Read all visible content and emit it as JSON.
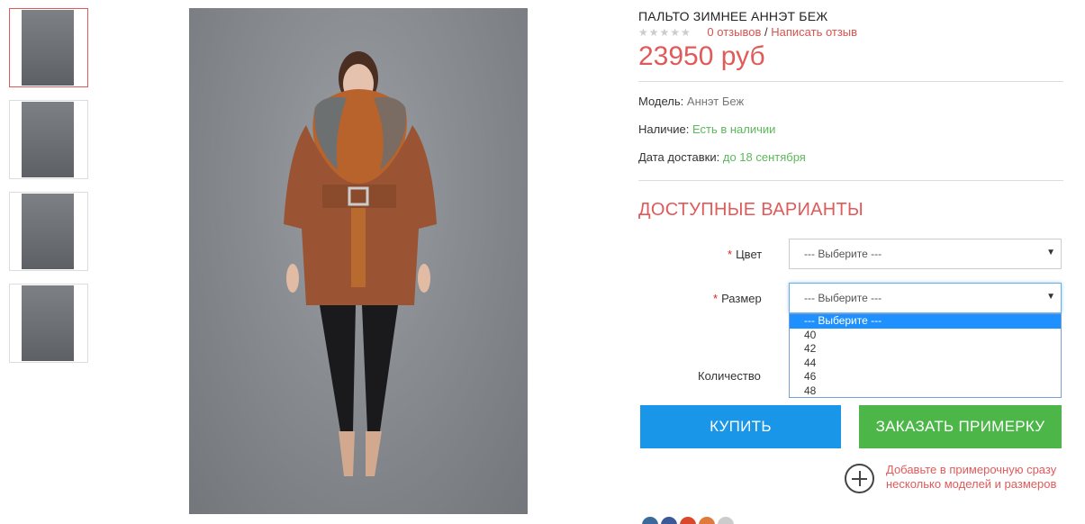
{
  "colors": {
    "accent_red": "#e05a5a",
    "buy_blue": "#1a96e8",
    "try_green": "#4cb649",
    "stock_green": "#5cb85c"
  },
  "thumbnails": [
    {
      "name": "thumb-1",
      "active": true
    },
    {
      "name": "thumb-2",
      "active": false
    },
    {
      "name": "thumb-3",
      "active": false
    },
    {
      "name": "thumb-4",
      "active": false
    }
  ],
  "product": {
    "title": "ПАЛЬТО ЗИМНЕЕ АННЭТ БЕЖ",
    "reviews_link": "0 отзывов",
    "separator": "/",
    "write_review_link": "Написать отзыв",
    "price": "23950 руб",
    "model_label": "Модель:",
    "model_value": "Аннэт Беж",
    "availability_label": "Наличие:",
    "availability_value": "Есть в наличии",
    "delivery_label": "Дата доставки:",
    "delivery_value": "до 18 сентября"
  },
  "options": {
    "title": "ДОСТУПНЫЕ ВАРИАНТЫ",
    "required_mark": "*",
    "color_label": "Цвет",
    "color_value": "--- Выберите ---",
    "size_label": "Размер",
    "size_value": "--- Выберите ---",
    "size_options": [
      "--- Выберите ---",
      "40",
      "42",
      "44",
      "46",
      "48"
    ],
    "quantity_label": "Количество"
  },
  "actions": {
    "buy_label": "КУПИТЬ",
    "try_label": "ЗАКАЗАТЬ ПРИМЕРКУ",
    "add_note": "Добавьте в примерочную сразу несколько моделей и размеров"
  },
  "social": [
    "vk-icon",
    "facebook-icon",
    "odnoklassniki-icon",
    "google-plus-icon",
    "more-icon"
  ]
}
